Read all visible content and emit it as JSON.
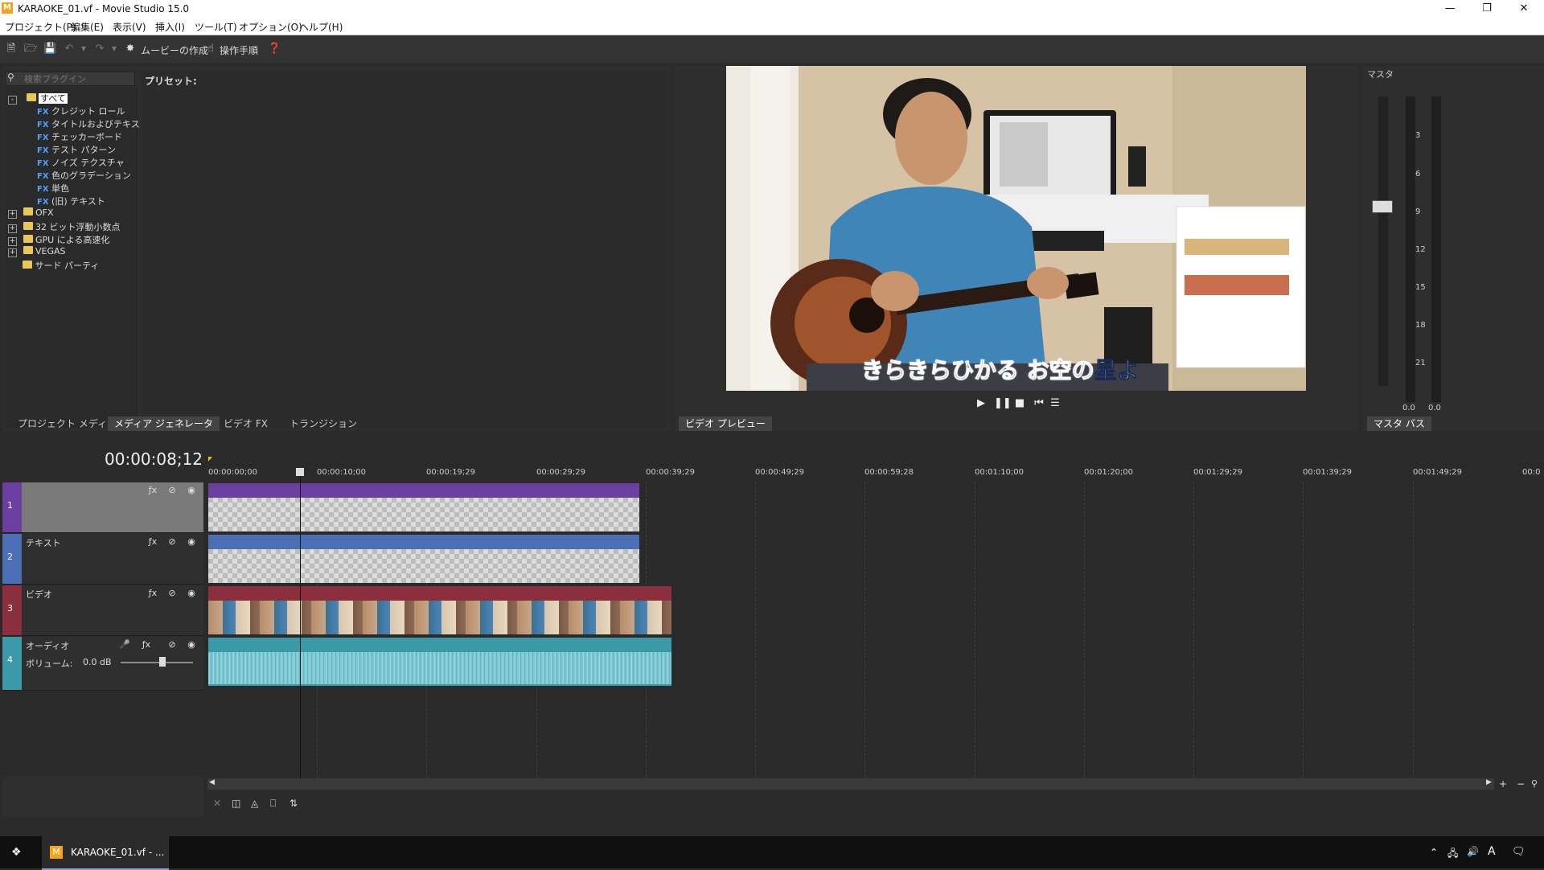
{
  "window": {
    "title": "KARAOKE_01.vf - Movie Studio 15.0",
    "icon_letter": "M",
    "min_icon": "minimize-icon",
    "max_icon": "restore-icon",
    "close_icon": "close-icon"
  },
  "menu": [
    "プロジェクト(P)",
    "編集(E)",
    "表示(V)",
    "挿入(I)",
    "ツール(T)",
    "オプション(O)",
    "ヘルプ(H)"
  ],
  "toolbar": {
    "make_movie": "ムービーの作成",
    "guide": "操作手順"
  },
  "plugin_panel": {
    "search_placeholder": "検索プラグイン",
    "preset_label": "プリセット:",
    "tree": [
      {
        "label": "すべて",
        "type": "folder",
        "expander": "-",
        "selected": true
      },
      {
        "label": "クレジット ロール",
        "type": "fx"
      },
      {
        "label": "タイトルおよびテキスト",
        "type": "fx"
      },
      {
        "label": "チェッカーボード",
        "type": "fx"
      },
      {
        "label": "テスト パターン",
        "type": "fx"
      },
      {
        "label": "ノイズ テクスチャ",
        "type": "fx"
      },
      {
        "label": "色のグラデーション",
        "type": "fx"
      },
      {
        "label": "単色",
        "type": "fx"
      },
      {
        "label": "(旧) テキスト",
        "type": "fx"
      },
      {
        "label": "OFX",
        "type": "folder",
        "expander": "+"
      },
      {
        "label": "32 ビット浮動小数点",
        "type": "folder",
        "expander": "+"
      },
      {
        "label": "GPU による高速化",
        "type": "folder",
        "expander": "+"
      },
      {
        "label": "VEGAS",
        "type": "folder",
        "expander": "+"
      },
      {
        "label": "サード パーティ",
        "type": "folder",
        "expander": ""
      }
    ],
    "fx_badge": "FX",
    "tabs": [
      "プロジェクト メディア",
      "メディア ジェネレータ",
      "ビデオ FX",
      "トランジション"
    ]
  },
  "preview": {
    "subtitle_highlight": "きらきらひかる お空の",
    "subtitle_rest": "星よ",
    "tab": "ビデオ プレビュー"
  },
  "master": {
    "label": "マスタ",
    "ticks": [
      "3",
      "6",
      "9",
      "12",
      "15",
      "18",
      "21"
    ],
    "left_value": "0.0",
    "right_value": "0.0",
    "tab": "マスタ バス"
  },
  "timeline": {
    "time": "00:00:08;12",
    "ruler": [
      "00:00:00;00",
      "00:00:10;00",
      "00:00:19;29",
      "00:00:29;29",
      "00:00:39;29",
      "00:00:49;29",
      "00:00:59;28",
      "00:01:10;00",
      "00:01:20;00",
      "00:01:29;29",
      "00:01:39;29",
      "00:01:49;29",
      "00:0"
    ],
    "tracks": [
      {
        "num": "1",
        "name": "",
        "color": "#6b3fa0"
      },
      {
        "num": "2",
        "name": "テキスト",
        "color": "#4a6fb5"
      },
      {
        "num": "3",
        "name": "ビデオ",
        "color": "#8b2e3d"
      },
      {
        "num": "4",
        "name": "オーディオ",
        "color": "#3a9aa8"
      }
    ],
    "volume_label": "ボリューム:",
    "volume_value": "0.0 dB"
  },
  "taskbar": {
    "app": "KARAOKE_01.vf - ...",
    "ime": "A"
  }
}
